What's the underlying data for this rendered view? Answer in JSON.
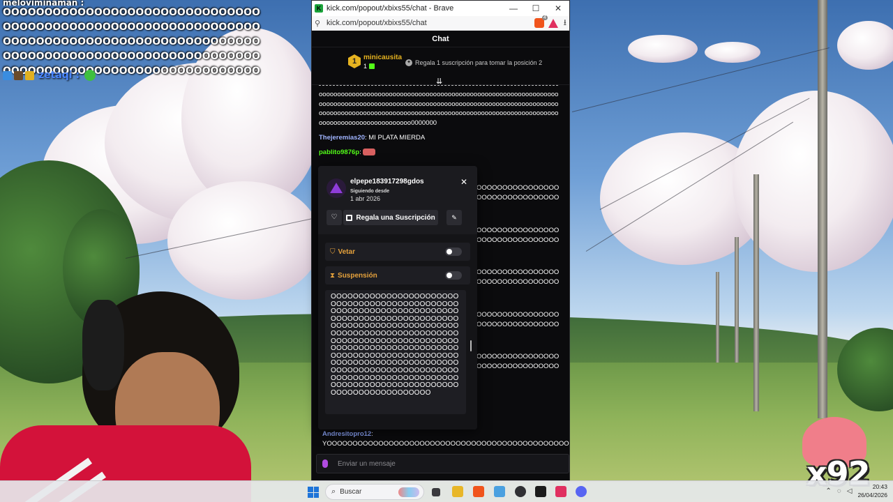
{
  "overlay": {
    "username_cut": "meloviminaman :",
    "message": "OOOOOOOOOOOOOOOOOOOOOOOOOOOOOOOOOOOOOOOOOOOOOOOOOOOOOOOOOOOOOOOOOOOOOOOOOOOOOOOOOOOOOOOOOOOOOOOOOOOOOOOOOOOOOOOOOOOOOOOOOOOOOOOOOOOOOOOOOOOOOOOOOOOOOOOOOOO",
    "next_user": "zetaqi :"
  },
  "browser": {
    "title": "kick.com/popout/xbixs55/chat - Brave",
    "url": "kick.com/popout/xbixs55/chat",
    "favicon_letter": "K",
    "brave_badge": "4",
    "minimize": "—",
    "maximize": "☐",
    "close": "✕"
  },
  "chat": {
    "header": "Chat",
    "pinned": {
      "rank": "1",
      "user": "minicausita",
      "count": "1",
      "gift_text": "Regala 1 suscripción para tomar la posición 2"
    },
    "messages": [
      {
        "user": "",
        "color": "#ffffff",
        "text": "oooooooooooooooooooooooooooooooooooooooooooooooooooooooooooooooooooooooooooooooooooooooooooooooooooooooooooooooooooooooooooooooooooooooooooooooooooooooooooooooooooooooooooooooooooooooooooooooooooooooooooooooooooooooooooo0000000"
      },
      {
        "user": "Thejeremias20",
        "color": "#a0b4ff",
        "text": ": MI PLATA MIERDA"
      },
      {
        "user": "pablito9876p",
        "color": "#53fc18",
        "text": ":"
      }
    ],
    "right_fragment": "OOOOOOOOOOOOOOOOOOOOOOOOOOOOOOOOOOOOOOOOOOOOOOOOOOOOOOOOO",
    "bottom_user": "Andresitopro12",
    "bottom_text": "YOOOOOOOOOOOOOOOOOOOOOOOOOOOOOOOOOOOOOOOOOOOOOOOOOOOOOOOOOOOOOOO",
    "input_placeholder": "Enviar un mensaje"
  },
  "usercard": {
    "username": "elpepe183917298gdos",
    "following_label": "Siguiendo desde",
    "following_date": "1 abr 2026",
    "gift_button": "Regala una Suscripción",
    "ban_label": "Vetar",
    "timeout_label": "Suspensión",
    "message": "OOOOOOOOOOOOOOOOOOOOOOOOOOOOOOOOOOOOOOOOOOOOOOOOOOOOOOOOOOOOOOOOOOOOOOOOOOOOOOOOOOOOOOOOOOOOOOOOOOOOOOOOOOOOOOOOOOOOOOOOOOOOOOOOOOOOOOOOOOOOOOOOOOOOOOOOOOOOOOOOOOOOOOOOOOOOOOOOOOOOOOOOOOOOOOOOOOOOOOOOOOOOOOOOOOOOOOOOOOOOOOOOOOOOOOOOOOOOOOOOOOOOOOOOOOOOOOOOOOOOOOOOOOOOOOOOOOOOOOOOOOOOOOOOOOOOOOOOOOOOOOOOOOOOOOOOOOOOO"
  },
  "stream": {
    "combo": "x92"
  },
  "taskbar": {
    "search_placeholder": "Buscar",
    "time": "20:43",
    "date": "26/04/2026"
  }
}
